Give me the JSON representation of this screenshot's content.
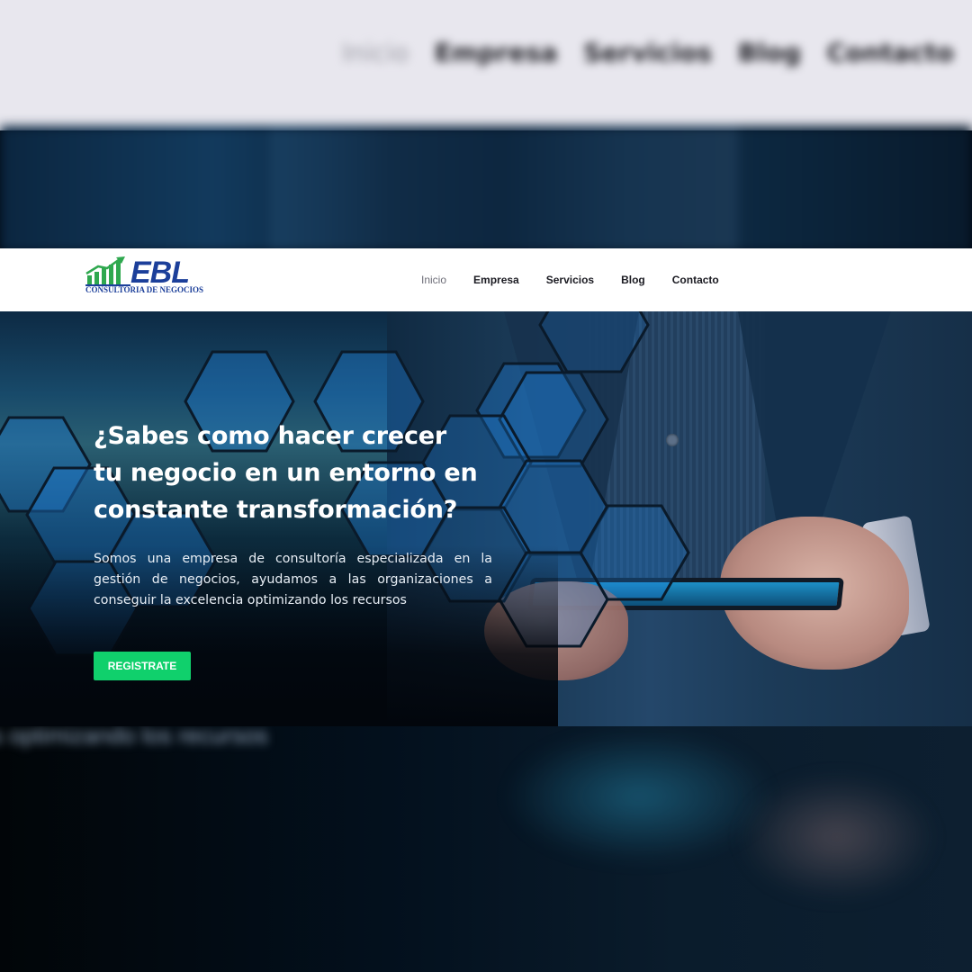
{
  "backdrop": {
    "menu": [
      "Inicio",
      "Empresa",
      "Servicios",
      "Blog",
      "Contacto"
    ],
    "echo_text": "s optimizando los recursos"
  },
  "brand": {
    "name": "EBL",
    "tagline": "CONSULTORIA DE NEGOCIOS",
    "colors": {
      "primary": "#1c3f9a",
      "accent": "#2fa84f"
    }
  },
  "nav": {
    "items": [
      {
        "label": "Inicio",
        "active": true
      },
      {
        "label": "Empresa",
        "active": false
      },
      {
        "label": "Servicios",
        "active": false
      },
      {
        "label": "Blog",
        "active": false
      },
      {
        "label": "Contacto",
        "active": false
      }
    ]
  },
  "hero": {
    "title_lines": [
      "¿Sabes como hacer crecer",
      "tu negocio en un entorno en",
      "constante transformación?"
    ],
    "description": "Somos una empresa de consultoría especializada en la gestión de negocios, ayudamos a las organizaciones a conseguir la excelencia optimizando los recursos",
    "cta_label": "REGISTRATE",
    "cta_color": "#10d06c"
  }
}
